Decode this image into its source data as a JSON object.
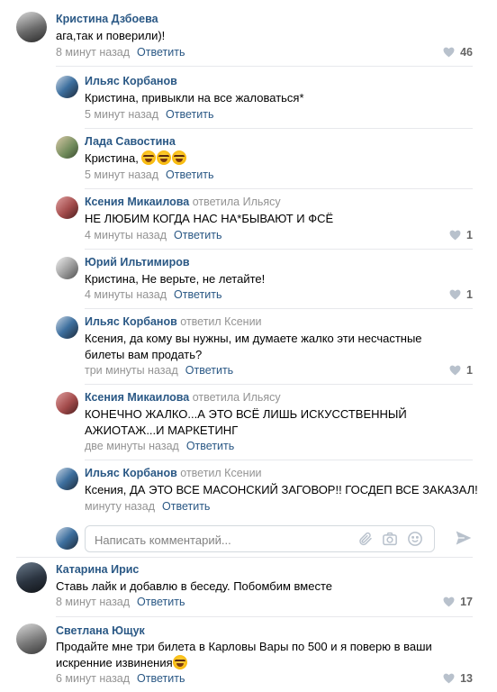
{
  "comments": [
    {
      "author": "Кристина Дзбоева",
      "replied": "",
      "text": "ага,так и поверили)!",
      "time": "8 минут назад",
      "reply": "Ответить",
      "likes": "46",
      "avatar_color": "#4a4a4a"
    },
    {
      "author": "Ильяс Корбанов",
      "replied": "",
      "text": "Кристина, привыкли на все жаловаться*",
      "time": "5 минут назад",
      "reply": "Ответить",
      "likes": "",
      "avatar_color": "#3d6f9e"
    },
    {
      "author": "Лада Савостина",
      "replied": "",
      "text": "Кристина,",
      "time": "5 минут назад",
      "reply": "Ответить",
      "likes": "",
      "avatar_color": "#6f8a5a"
    },
    {
      "author": "Ксения Микаилова",
      "replied": "ответила Ильясу",
      "text": "НЕ ЛЮБИМ КОГДА НАС НА*БЫВАЮТ И ФСЁ",
      "time": "4 минуты назад",
      "reply": "Ответить",
      "likes": "1",
      "avatar_color": "#a34b4b"
    },
    {
      "author": "Юрий Ильтимиров",
      "replied": "",
      "text": "Кристина, Не верьте, не летайте!",
      "time": "4 минуты назад",
      "reply": "Ответить",
      "likes": "1",
      "avatar_color": "#9a9a9a"
    },
    {
      "author": "Ильяс Корбанов",
      "replied": "ответил Ксении",
      "text": "Ксения, да кому вы нужны, им думаете жалко эти несчастные билеты вам продать?",
      "time": "три минуты назад",
      "reply": "Ответить",
      "likes": "1",
      "avatar_color": "#3d6f9e"
    },
    {
      "author": "Ксения Микаилова",
      "replied": "ответила Ильясу",
      "text": "КОНЕЧНО ЖАЛКО...А ЭТО ВСЁ ЛИШЬ ИСКУССТВЕННЫЙ АЖИОТАЖ...И МАРКЕТИНГ",
      "time": "две минуты назад",
      "reply": "Ответить",
      "likes": "",
      "avatar_color": "#a34b4b"
    },
    {
      "author": "Ильяс Корбанов",
      "replied": "ответил Ксении",
      "text": "Ксения, ДА ЭТО ВСЕ МАСОНСКИЙ ЗАГОВОР!! ГОСДЕП ВСЕ ЗАКАЗАЛ!",
      "time": "минуту назад",
      "reply": "Ответить",
      "likes": "",
      "avatar_color": "#3d6f9e"
    },
    {
      "author": "Катарина Ирис",
      "replied": "",
      "text": "Ставь лайк и добавлю в беседу. Побомбим вместе",
      "time": "8 минут назад",
      "reply": "Ответить",
      "likes": "17",
      "avatar_color": "#2b3440"
    },
    {
      "author": "Светлана Ющук",
      "replied": "",
      "text": "Продайте мне три билета в Карловы Вары по 500 и я поверю в ваши искренние извинения",
      "time": "6 минут назад",
      "reply": "Ответить",
      "likes": "13",
      "avatar_color": "#7a7a7a"
    }
  ],
  "composer": {
    "placeholder": "Написать комментарий..."
  },
  "colors": {
    "link": "#2a5885",
    "meta": "#939393",
    "divider": "#e7e8ec",
    "icon": "#b8c1cc"
  }
}
